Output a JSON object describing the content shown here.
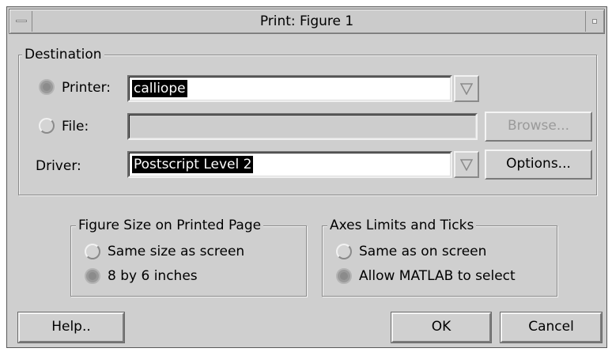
{
  "window": {
    "title": "Print: Figure 1"
  },
  "destination": {
    "legend": "Destination",
    "printer_label": "Printer:",
    "printer_value": "calliope",
    "file_label": "File:",
    "file_value": "",
    "browse_label": "Browse...",
    "driver_label": "Driver:",
    "driver_value": "Postscript Level 2",
    "options_label": "Options..."
  },
  "figure_size": {
    "legend": "Figure Size on Printed Page",
    "option1": "Same size as screen",
    "option2": "8 by 6 inches",
    "selected": "8 by 6 inches"
  },
  "axes": {
    "legend": "Axes Limits and Ticks",
    "option1": "Same as on screen",
    "option2": "Allow MATLAB to select",
    "selected": "Allow MATLAB to select"
  },
  "buttons": {
    "help": "Help..",
    "ok": "OK",
    "cancel": "Cancel"
  },
  "icons": {
    "dropdown": "triangle-down-icon",
    "window_menu": "window-menu-icon",
    "maximize": "maximize-icon"
  },
  "colors": {
    "dialog_bg": "#cfcfcf",
    "selection_bg": "#000000",
    "selection_fg": "#ffffff"
  }
}
